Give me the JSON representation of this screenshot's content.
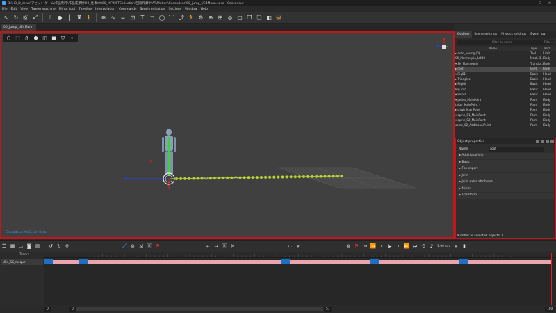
{
  "titlebar": {
    "title": "D:\\HB_D_drive\\アセット\\ゲーム\\作品制作\\作品成果物\\00_仕事\\0000_MF\\MFTCollection\\回廊作業\\MAT\\Motion\\Cascadeur\\00_jump_UE4Mann.casc - Cascadeur",
    "minimize": "─",
    "maximize": "☐",
    "close": "✕"
  },
  "menu": [
    "File",
    "Edit",
    "View",
    "Tween machine",
    "Mirror tool",
    "Timeline",
    "Interpolation",
    "Commands",
    "Synchronization",
    "Settings",
    "Window",
    "Help"
  ],
  "doc_tab": "00_jump_UE4Mann",
  "viewport": {
    "caption": "Cascadeur 2022.1(in Beta)",
    "axis_x": "X"
  },
  "right_panel": {
    "tabs": [
      "Outliner",
      "Scene settings",
      "Physics settings",
      "Event log"
    ],
    "filter_placeholder": "Filter by name",
    "filter_right": "Filte...",
    "columns": [
      "Name",
      "Type",
      "Track"
    ],
    "rows": [
      {
        "name": "▸ auto_posing (0)",
        "type": "Tool",
        "track": "Limb"
      },
      {
        "name": "  SK_Mannequin_LOD0",
        "type": "Mesh O...",
        "track": "Body"
      },
      {
        "name": "▾ SK_Mannequin",
        "type": "Transfo...",
        "track": "Body"
      },
      {
        "name": "    ▸ root",
        "type": "Joint",
        "track": "Body"
      },
      {
        "name": "▾ Rig01",
        "type": "Basic",
        "track": "Head"
      },
      {
        "name": "    ▸ Triangles",
        "type": "Basic",
        "track": "Head"
      },
      {
        "name": "    ▸ Rigids",
        "type": "Basic",
        "track": "Head"
      },
      {
        "name": "      Rig Info",
        "type": "Basic",
        "track": "Head"
      },
      {
        "name": "    ▾ Points",
        "type": "Basic",
        "track": "Head"
      },
      {
        "name": "        ▾ pelvis_MainPoint",
        "type": "Point",
        "track": "Body"
      },
      {
        "name": "            thigh_MainPoint_r",
        "type": "Point",
        "track": "Body"
      },
      {
        "name": "          ▸ thigh_MainPoint_l",
        "type": "Point",
        "track": "Body"
      },
      {
        "name": "          ▾ spine_01_MainPoint",
        "type": "Point",
        "track": "Body"
      },
      {
        "name": "            ▾ spine_02_MainPoint",
        "type": "Point",
        "track": "Body"
      },
      {
        "name": "                spine_02_AdditionalPoint",
        "type": "Point",
        "track": "Body"
      }
    ],
    "selected_row": 3
  },
  "object_properties": {
    "title": "Object properties",
    "name_label": "Name",
    "name_value": "root",
    "sections": [
      "Additional info",
      "Basic",
      "Fbx export",
      "Joint",
      "Joint extra attributes",
      "Mirror",
      "Transform"
    ],
    "status": "Number of selected objects: 1"
  },
  "timeline": {
    "fps": "1.00 sec",
    "tracks_label": "Tracks",
    "track_name": "UE4_SK_mequin",
    "frame_start": "0",
    "frame_current": "0",
    "frame_mid": "57",
    "frame_end": "100"
  },
  "colors": {
    "accent_red": "#c0161c",
    "key_blue": "#1b6fc4",
    "track_pink": "#e8a5ad",
    "point_green": "#b8d438"
  }
}
